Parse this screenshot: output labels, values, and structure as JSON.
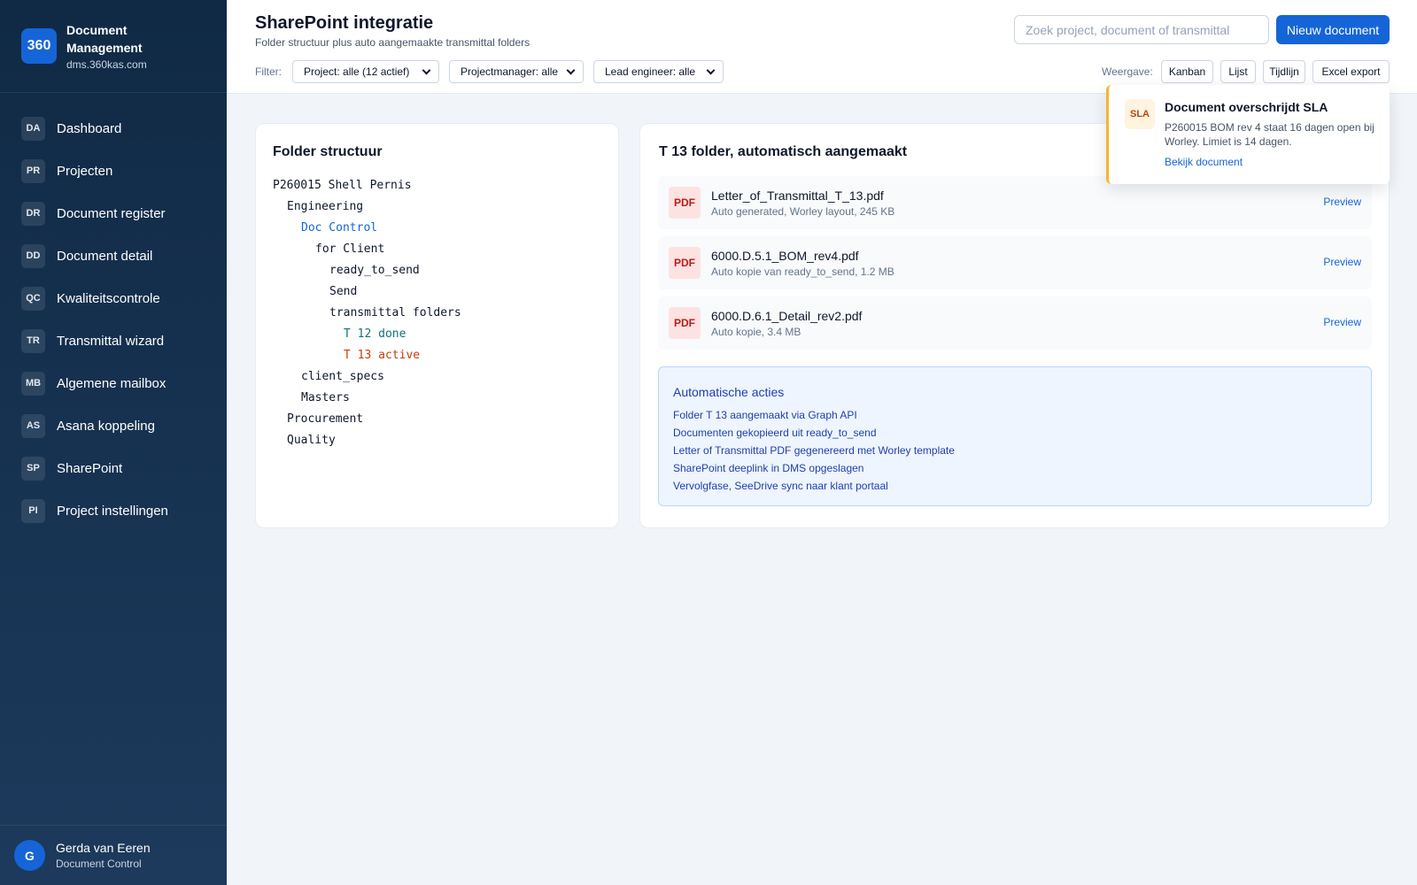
{
  "brand": {
    "logo": "360",
    "name": "Document Management",
    "domain": "dms.360kas.com"
  },
  "sidebar": {
    "items": [
      {
        "abbr": "DA",
        "label": "Dashboard"
      },
      {
        "abbr": "PR",
        "label": "Projecten"
      },
      {
        "abbr": "DR",
        "label": "Document register"
      },
      {
        "abbr": "DD",
        "label": "Document detail"
      },
      {
        "abbr": "QC",
        "label": "Kwaliteitscontrole"
      },
      {
        "abbr": "TR",
        "label": "Transmittal wizard"
      },
      {
        "abbr": "MB",
        "label": "Algemene mailbox"
      },
      {
        "abbr": "AS",
        "label": "Asana koppeling"
      },
      {
        "abbr": "SP",
        "label": "SharePoint"
      },
      {
        "abbr": "PI",
        "label": "Project instellingen"
      }
    ]
  },
  "user": {
    "initial": "G",
    "name": "Gerda van Eeren",
    "role": "Document Control"
  },
  "header": {
    "title": "SharePoint integratie",
    "subtitle": "Folder structuur plus auto aangemaakte transmittal folders",
    "search_placeholder": "Zoek project, document of transmittal",
    "new_button": "Nieuw document",
    "filter_label": "Filter:",
    "filters": [
      "Project: alle (12 actief)",
      "Projectmanager: alle",
      "Lead engineer: alle"
    ],
    "view_label": "Weergave:",
    "views": [
      "Kanban",
      "Lijst",
      "Tijdlijn",
      "Excel export"
    ]
  },
  "folder_card": {
    "title": "Folder structuur",
    "tree": [
      {
        "text": "P260015 Shell Pernis",
        "indent": 0,
        "tone": "default"
      },
      {
        "text": "Engineering",
        "indent": 1,
        "tone": "default"
      },
      {
        "text": "Doc Control",
        "indent": 2,
        "tone": "blue"
      },
      {
        "text": "for Client",
        "indent": 3,
        "tone": "default"
      },
      {
        "text": "ready_to_send",
        "indent": 4,
        "tone": "default"
      },
      {
        "text": "Send",
        "indent": 4,
        "tone": "default"
      },
      {
        "text": "transmittal folders",
        "indent": 4,
        "tone": "default"
      },
      {
        "text": "T 12 done",
        "indent": 5,
        "tone": "green"
      },
      {
        "text": "T 13 active",
        "indent": 5,
        "tone": "orange"
      },
      {
        "text": "client_specs",
        "indent": 2,
        "tone": "default"
      },
      {
        "text": "Masters",
        "indent": 2,
        "tone": "default"
      },
      {
        "text": "Procurement",
        "indent": 1,
        "tone": "default"
      },
      {
        "text": "Quality",
        "indent": 1,
        "tone": "default"
      }
    ]
  },
  "t13_card": {
    "title": "T 13 folder, automatisch aangemaakt",
    "files": [
      {
        "type": "PDF",
        "name": "Letter_of_Transmittal_T_13.pdf",
        "meta": "Auto generated, Worley layout, 245 KB",
        "action": "Preview"
      },
      {
        "type": "PDF",
        "name": "6000.D.5.1_BOM_rev4.pdf",
        "meta": "Auto kopie van ready_to_send, 1.2 MB",
        "action": "Preview"
      },
      {
        "type": "PDF",
        "name": "6000.D.6.1_Detail_rev2.pdf",
        "meta": "Auto kopie, 3.4 MB",
        "action": "Preview"
      }
    ],
    "actions_title": "Automatische acties",
    "actions": [
      "Folder T 13 aangemaakt via Graph API",
      "Documenten gekopieerd uit ready_to_send",
      "Letter of Transmittal PDF gegenereerd met Worley template",
      "SharePoint deeplink in DMS opgeslagen",
      "Vervolgfase, SeeDrive sync naar klant portaal"
    ]
  },
  "toast": {
    "badge": "SLA",
    "title": "Document overschrijdt SLA",
    "body": "P260015 BOM rev 4 staat 16 dagen open bij Worley. Limiet is 14 dagen.",
    "link": "Bekijk document"
  },
  "colors": {
    "primary": "#1565d8",
    "sidebar": "#102a45",
    "warning": "#f5b62b",
    "pdf": "#b91c1c"
  }
}
